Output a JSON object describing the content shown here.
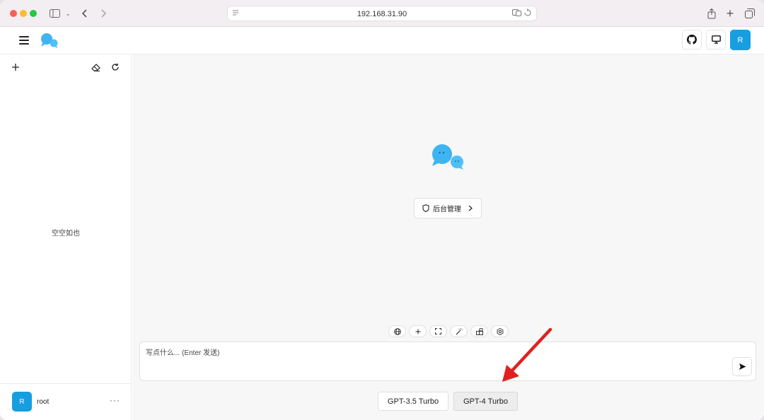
{
  "browser": {
    "address": "192.168.31.90"
  },
  "header": {
    "avatar_initial": "R"
  },
  "sidebar": {
    "empty_text": "空空如也",
    "user": {
      "initial": "R",
      "name": "root",
      "more": "···"
    }
  },
  "main": {
    "admin_button_label": "后台管理",
    "input_placeholder": "写点什么... (Enter 发送)",
    "models": [
      "GPT-3.5 Turbo",
      "GPT-4 Turbo"
    ],
    "selected_model": "GPT-4 Turbo"
  },
  "colors": {
    "accent": "#169ee0",
    "annotation_arrow": "#e02020"
  },
  "icons": {
    "toolbar": [
      "globe-icon",
      "plus-icon",
      "fullscreen-icon",
      "magic-wand-icon",
      "plugin-icon",
      "settings-icon"
    ]
  }
}
